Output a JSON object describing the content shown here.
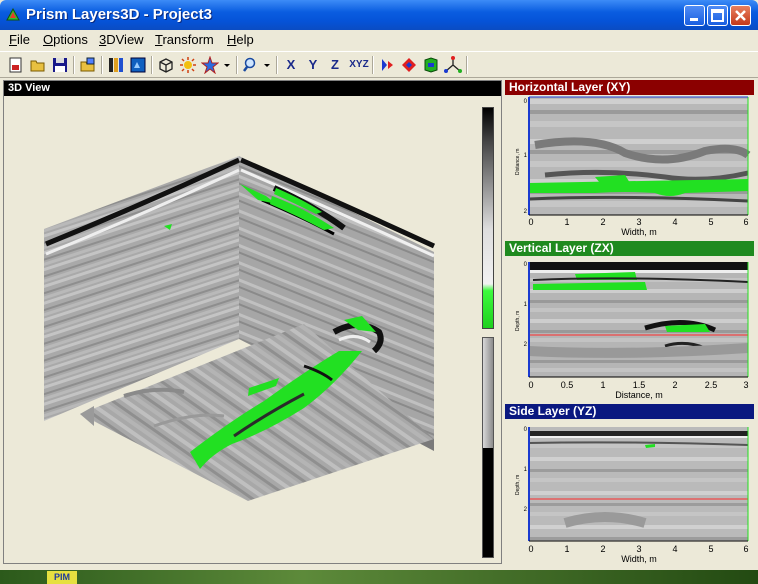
{
  "window": {
    "title": "Prism Layers3D - Project3",
    "controls": [
      "minimize-icon",
      "maximize-icon",
      "close-icon"
    ]
  },
  "menu": {
    "items": [
      {
        "label": "File"
      },
      {
        "label": "Options"
      },
      {
        "label": "3DView"
      },
      {
        "label": "Transform"
      },
      {
        "label": "Help"
      }
    ]
  },
  "toolbar": {
    "buttons": [
      "new-document-icon",
      "open-folder-icon",
      "save-disk-icon",
      "open-project-icon",
      "palette-icon",
      "image-icon",
      "cube-view-icon",
      "light-icon",
      "rotate-star-icon",
      "zoom-icon",
      "rotate-x-icon",
      "rotate-y-icon",
      "rotate-z-icon",
      "rotate-xyz-icon",
      "axis-x-icon",
      "axis-y-icon",
      "axis-z-icon",
      "axis-all-icon"
    ],
    "rotate_labels": {
      "x": "X",
      "y": "Y",
      "z": "Z",
      "xyz": "XYZ"
    }
  },
  "view3d": {
    "title": "3D View"
  },
  "colors": {
    "green": "#22e022",
    "horizontal_header": "#8b0000",
    "vertical_header": "#1f8a1f",
    "side_header": "#0a1880",
    "red_line": "#ff2a2a",
    "titlebar": "#0553d8"
  },
  "panels": {
    "horizontal": {
      "title": "Horizontal Layer (XY)",
      "ylabel": "Distance, m",
      "xlabel": "Width, m",
      "xticks": [
        "0",
        "1",
        "2",
        "3",
        "4",
        "5",
        "6"
      ],
      "yticks": [
        "0",
        "1",
        "2"
      ]
    },
    "vertical": {
      "title": "Vertical Layer (ZX)",
      "ylabel": "Depth, m",
      "xlabel": "Distance, m",
      "xticks": [
        "0",
        "0.5",
        "1",
        "1.5",
        "2",
        "2.5",
        "3"
      ],
      "yticks": [
        "0",
        "1",
        "2"
      ]
    },
    "side": {
      "title": "Side Layer (YZ)",
      "ylabel": "Depth, m",
      "xlabel": "Width, m",
      "xticks": [
        "0",
        "1",
        "2",
        "3",
        "4",
        "5",
        "6"
      ],
      "yticks": [
        "0",
        "1",
        "2"
      ]
    }
  },
  "taskbar": {
    "tray_label": "PIM"
  }
}
